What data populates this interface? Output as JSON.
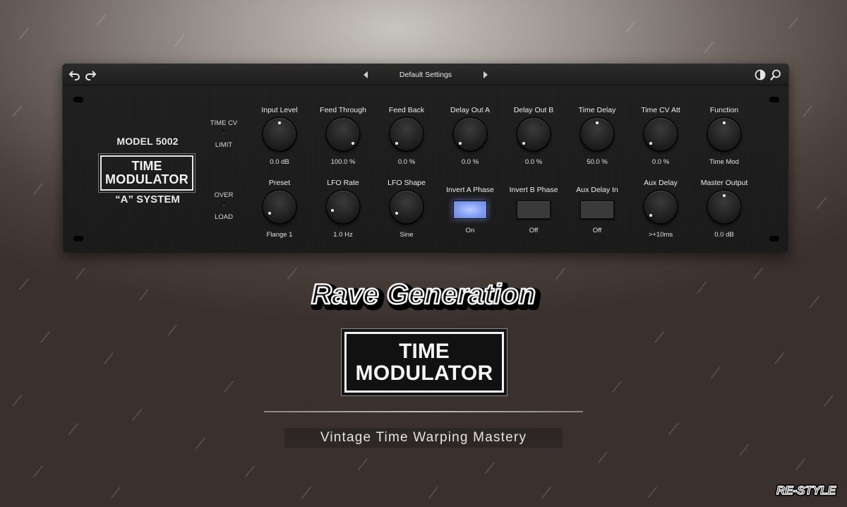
{
  "toolbar": {
    "undo_icon": "undo-icon",
    "redo_icon": "redo-icon",
    "preset_name": "Default Settings",
    "contrast_icon": "contrast-icon",
    "zoom_icon": "magnifier-icon"
  },
  "panel": {
    "model": "MODEL 5002",
    "logo_line1": "TIME",
    "logo_line2": "MODULATOR",
    "system": "“A” SYSTEM",
    "led_time_cv_top": "TIME CV",
    "led_time_cv_bottom": "LIMIT",
    "led_over_top": "OVER",
    "led_over_bottom": "LOAD"
  },
  "controls_row1": [
    {
      "label": "Input Level",
      "value": "0.0 dB",
      "type": "knob"
    },
    {
      "label": "Feed Through",
      "value": "100.0 %",
      "type": "knob"
    },
    {
      "label": "Feed Back",
      "value": "0.0 %",
      "type": "knob"
    },
    {
      "label": "Delay Out A",
      "value": "0.0 %",
      "type": "knob"
    },
    {
      "label": "Delay Out B",
      "value": "0.0 %",
      "type": "knob"
    },
    {
      "label": "Time Delay",
      "value": "50.0 %",
      "type": "knob"
    },
    {
      "label": "Time CV Att",
      "value": "0.0 %",
      "type": "knob"
    },
    {
      "label": "Function",
      "value": "Time Mod",
      "type": "knob"
    }
  ],
  "controls_row2": [
    {
      "label": "Preset",
      "value": "Flange 1",
      "type": "knob"
    },
    {
      "label": "LFO Rate",
      "value": "1.0 Hz",
      "type": "knob"
    },
    {
      "label": "LFO Shape",
      "value": "Sine",
      "type": "knob"
    },
    {
      "label": "Invert A Phase",
      "value": "On",
      "type": "toggle",
      "on": true
    },
    {
      "label": "Invert B Phase",
      "value": "Off",
      "type": "toggle",
      "on": false
    },
    {
      "label": "Aux Delay In",
      "value": "Off",
      "type": "toggle",
      "on": false
    },
    {
      "label": "Aux Delay",
      "value": ">+10ms",
      "type": "knob"
    },
    {
      "label": "Master Output",
      "value": "0.0 dB",
      "type": "knob"
    }
  ],
  "branding": {
    "rave_text": "Rave Generation",
    "logo_line1": "TIME",
    "logo_line2": "MODULATOR",
    "tagline": "Vintage Time Warping Mastery",
    "brand_text": "RE-STYLE"
  },
  "colors": {
    "toggle_on": "#8aa6f6",
    "panel": "#1c1c1c",
    "text": "#ececec"
  }
}
